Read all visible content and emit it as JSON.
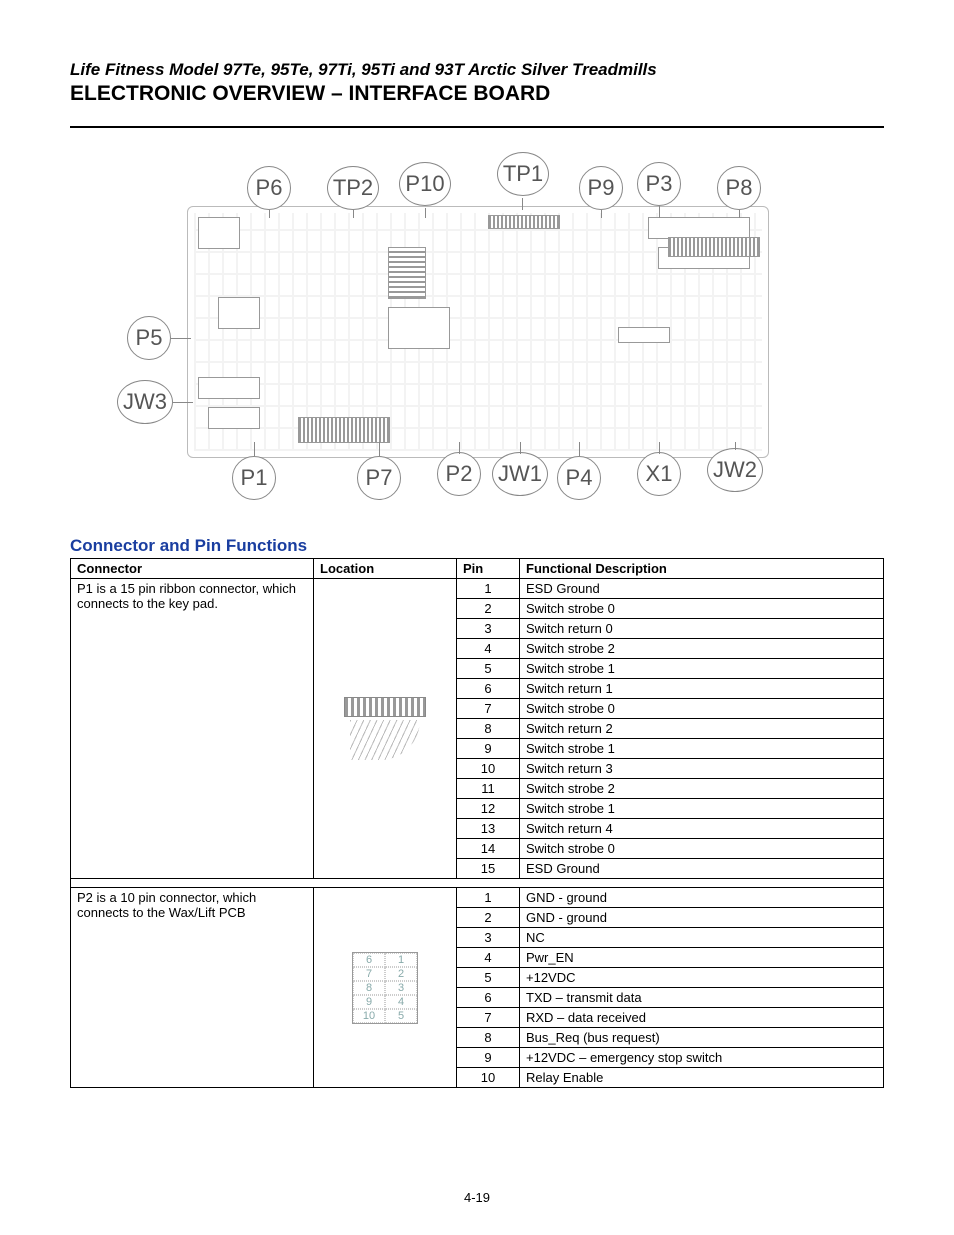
{
  "header": {
    "model_line": "Life Fitness Model 97Te, 95Te, 97Ti, 95Ti and 93T Arctic Silver Treadmills",
    "title": "ELECTRONIC OVERVIEW – INTERFACE BOARD"
  },
  "diagram": {
    "callouts": [
      "P6",
      "TP2",
      "P10",
      "TP1",
      "P9",
      "P3",
      "P8",
      "P5",
      "JW3",
      "P1",
      "P7",
      "P2",
      "JW1",
      "P4",
      "X1",
      "JW2"
    ]
  },
  "section_title": "Connector and Pin Functions",
  "table": {
    "headers": [
      "Connector",
      "Location",
      "Pin",
      "Functional Description"
    ],
    "groups": [
      {
        "connector_desc": "P1 is a 15 pin ribbon connector, which connects to the key pad.",
        "loc_type": "ribbon",
        "rows": [
          {
            "pin": "1",
            "desc": "ESD Ground"
          },
          {
            "pin": "2",
            "desc": "Switch strobe 0"
          },
          {
            "pin": "3",
            "desc": "Switch return 0"
          },
          {
            "pin": "4",
            "desc": "Switch strobe 2"
          },
          {
            "pin": "5",
            "desc": "Switch strobe 1"
          },
          {
            "pin": "6",
            "desc": "Switch return 1"
          },
          {
            "pin": "7",
            "desc": "Switch strobe 0"
          },
          {
            "pin": "8",
            "desc": "Switch return 2"
          },
          {
            "pin": "9",
            "desc": "Switch strobe 1"
          },
          {
            "pin": "10",
            "desc": "Switch return 3"
          },
          {
            "pin": "11",
            "desc": "Switch strobe 2"
          },
          {
            "pin": "12",
            "desc": "Switch strobe 1"
          },
          {
            "pin": "13",
            "desc": "Switch return 4"
          },
          {
            "pin": "14",
            "desc": "Switch strobe 0"
          },
          {
            "pin": "15",
            "desc": "ESD Ground"
          }
        ]
      },
      {
        "connector_desc": "P2 is a 10 pin connector, which connects to the Wax/Lift PCB",
        "loc_type": "pinbox",
        "loc_pins_left": [
          "6",
          "7",
          "8",
          "9",
          "10"
        ],
        "loc_pins_right": [
          "1",
          "2",
          "3",
          "4",
          "5"
        ],
        "rows": [
          {
            "pin": "1",
            "desc": "GND - ground"
          },
          {
            "pin": "2",
            "desc": "GND - ground"
          },
          {
            "pin": "3",
            "desc": "NC"
          },
          {
            "pin": "4",
            "desc": "Pwr_EN"
          },
          {
            "pin": "5",
            "desc": "+12VDC"
          },
          {
            "pin": "6",
            "desc": "TXD – transmit data"
          },
          {
            "pin": "7",
            "desc": "RXD – data received"
          },
          {
            "pin": "8",
            "desc": "Bus_Req (bus request)"
          },
          {
            "pin": "9",
            "desc": "+12VDC – emergency stop switch"
          },
          {
            "pin": "10",
            "desc": "Relay Enable"
          }
        ]
      }
    ]
  },
  "page_number": "4-19"
}
